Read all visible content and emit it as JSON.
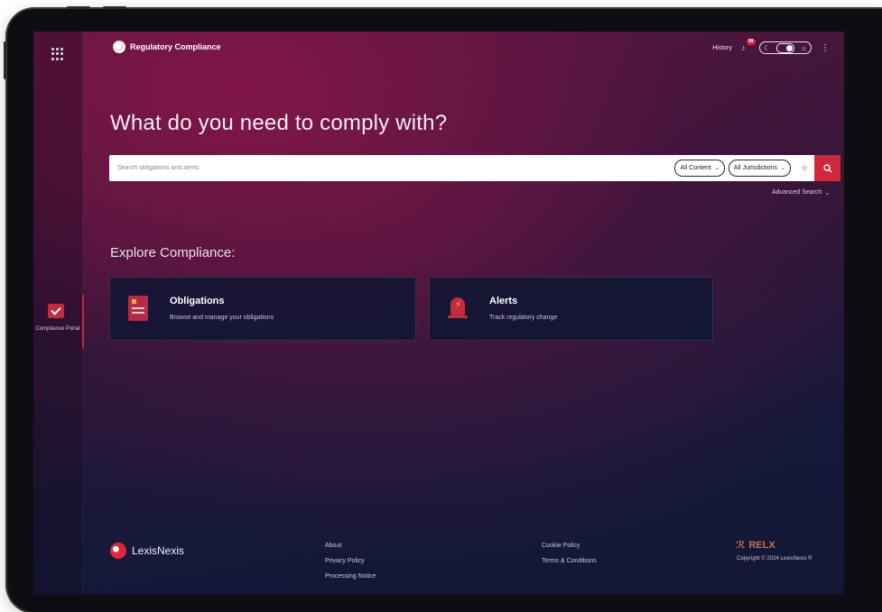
{
  "app": {
    "title": "Regulatory Compliance"
  },
  "header": {
    "history_label": "History",
    "notification_count": "99"
  },
  "rail": {
    "portal_label": "Compliance Portal"
  },
  "hero": {
    "headline": "What do you need to comply with?"
  },
  "search": {
    "placeholder": "Search obligations and alerts",
    "content_filter": "All Content",
    "jurisdiction_filter": "All Jurisdictions",
    "advanced_label": "Advanced Search"
  },
  "explore": {
    "heading": "Explore Compliance:",
    "cards": [
      {
        "title": "Obligations",
        "subtitle": "Browse and manage your obligations"
      },
      {
        "title": "Alerts",
        "subtitle": "Track regulatory change"
      }
    ]
  },
  "footer": {
    "brand": "LexisNexis",
    "links_col1": [
      "About",
      "Privacy Policy",
      "Processing Notice"
    ],
    "links_col2": [
      "Cookie Policy",
      "Terms & Conditions"
    ],
    "relx": "RELX",
    "copyright": "Copyright © 2024 LexisNexis ®"
  },
  "colors": {
    "accent": "#d0293d",
    "bg_start": "#5a1540",
    "bg_end": "#111733"
  }
}
